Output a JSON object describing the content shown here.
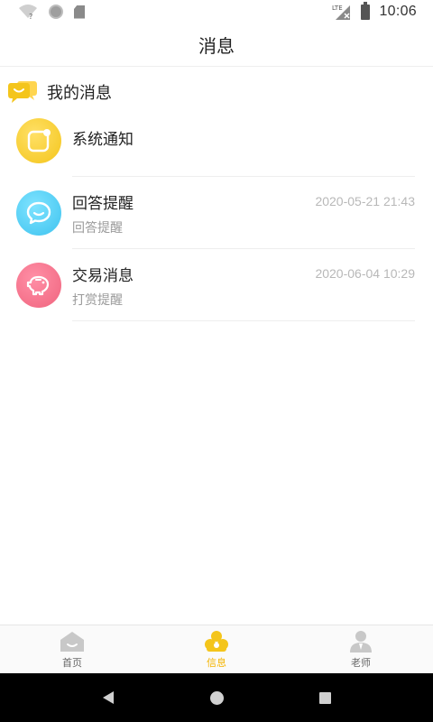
{
  "status_bar": {
    "time": "10:06",
    "network_label": "LTE",
    "icons": [
      "wifi-icon",
      "circle-icon",
      "sd-card-icon",
      "lte-signal-icon",
      "battery-icon"
    ]
  },
  "header": {
    "title": "消息"
  },
  "section": {
    "title": "我的消息",
    "icon": "chat-bubble-icon"
  },
  "messages": [
    {
      "title": "系统通知",
      "subtitle": "",
      "time": "",
      "icon": "notification-icon",
      "color": "#f4c51b"
    },
    {
      "title": "回答提醒",
      "subtitle": "回答提醒",
      "time": "2020-05-21 21:43",
      "icon": "chat-icon",
      "color": "#3ec3ef"
    },
    {
      "title": "交易消息",
      "subtitle": "打赏提醒",
      "time": "2020-06-04 10:29",
      "icon": "piggy-bank-icon",
      "color": "#f0647e"
    }
  ],
  "bottom_nav": {
    "items": [
      {
        "label": "首页",
        "icon": "home-icon",
        "active": false
      },
      {
        "label": "信息",
        "icon": "message-icon",
        "active": true
      },
      {
        "label": "老师",
        "icon": "teacher-icon",
        "active": false
      }
    ],
    "active_color": "#f4b400"
  }
}
